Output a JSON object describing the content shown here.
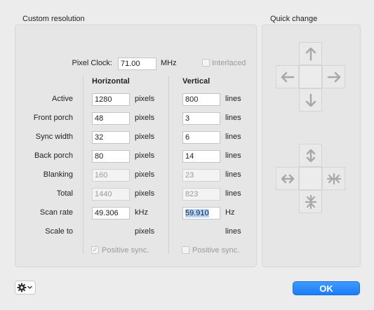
{
  "titles": {
    "custom_resolution": "Custom resolution",
    "quick_change": "Quick change"
  },
  "pixel_clock": {
    "label": "Pixel Clock:",
    "value": "71.00",
    "unit": "MHz"
  },
  "interlaced": {
    "label": "Interlaced",
    "checked": false
  },
  "headers": {
    "horizontal": "Horizontal",
    "vertical": "Vertical"
  },
  "rows": {
    "active": {
      "label": "Active",
      "h": "1280",
      "h_unit": "pixels",
      "v": "800",
      "v_unit": "lines"
    },
    "front_porch": {
      "label": "Front porch",
      "h": "48",
      "h_unit": "pixels",
      "v": "3",
      "v_unit": "lines"
    },
    "sync_width": {
      "label": "Sync width",
      "h": "32",
      "h_unit": "pixels",
      "v": "6",
      "v_unit": "lines"
    },
    "back_porch": {
      "label": "Back porch",
      "h": "80",
      "h_unit": "pixels",
      "v": "14",
      "v_unit": "lines"
    },
    "blanking": {
      "label": "Blanking",
      "h": "160",
      "h_unit": "pixels",
      "v": "23",
      "v_unit": "lines"
    },
    "total": {
      "label": "Total",
      "h": "1440",
      "h_unit": "pixels",
      "v": "823",
      "v_unit": "lines"
    },
    "scan_rate": {
      "label": "Scan rate",
      "h": "49.306",
      "h_unit": "kHz",
      "v": "59.910",
      "v_unit": "Hz"
    },
    "scale_to": {
      "label": "Scale to",
      "h_unit": "pixels",
      "v_unit": "lines"
    }
  },
  "positive_sync": {
    "horizontal": {
      "label": "Positive sync.",
      "checked": true
    },
    "vertical": {
      "label": "Positive sync.",
      "checked": false
    }
  },
  "buttons": {
    "ok": "OK"
  },
  "icons": {
    "gear": "gear-icon",
    "arrows": [
      "arrow-up-icon",
      "arrow-left-icon",
      "arrow-right-icon",
      "arrow-down-icon"
    ],
    "scale": [
      "expand-vertical-icon",
      "expand-horizontal-icon",
      "shrink-horizontal-icon",
      "shrink-vertical-icon"
    ]
  },
  "colors": {
    "accent": "#1b7cf6",
    "selection": "#b3d4fc"
  }
}
